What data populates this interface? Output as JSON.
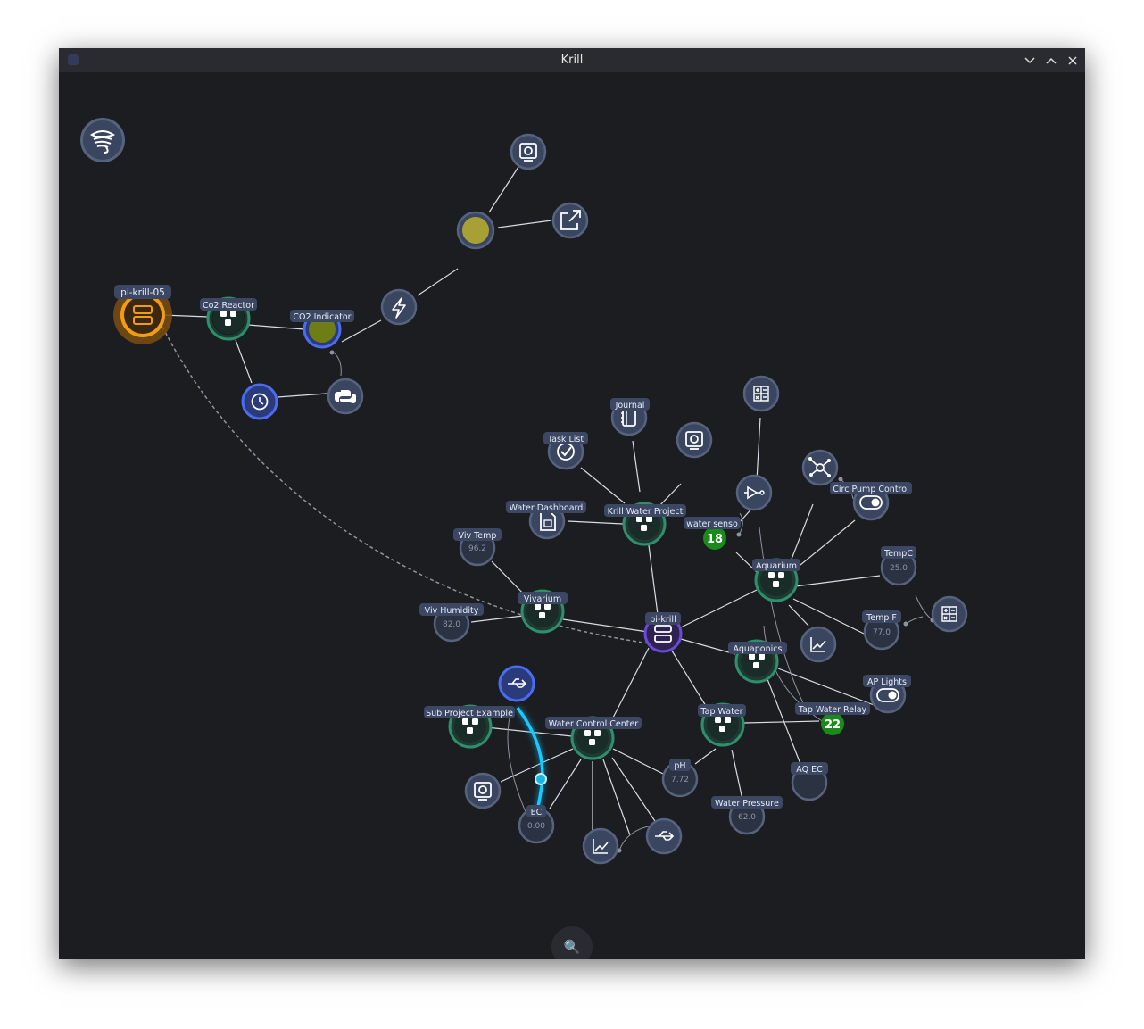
{
  "window": {
    "title": "Krill"
  },
  "search": {
    "icon": "search-icon",
    "glyph": "🔍"
  },
  "nodes": {
    "pi_krill_05": "pi-krill-05",
    "co2_reactor": "Co2 Reactor",
    "co2_indicator": "CO2 Indicator",
    "journal": "Journal",
    "task_list": "Task List",
    "water_dashboard": "Water Dashboard",
    "krill_water_project": "Krill Water Project",
    "water_sensor": "water senso",
    "circ_pump_control": "Circ Pump Control",
    "tempc": "TempC",
    "aquarium": "Aquarium",
    "temp_f": "Temp F",
    "viv_temp": "Viv Temp",
    "vivarium": "Vivarium",
    "viv_humidity": "Viv Humidity",
    "pi_krill": "pi-krill",
    "aquaponics": "Aquaponics",
    "ap_lights": "AP Lights",
    "sub_project_example": "Sub Project Example",
    "water_control_center": "Water Control Center",
    "tap_water": "Tap Water",
    "tap_water_relay": "Tap Water Relay",
    "ph": "pH",
    "aq_ec": "AQ EC",
    "ec": "EC",
    "water_pressure": "Water Pressure"
  },
  "values": {
    "viv_temp": "96.2",
    "viv_humidity": "82.0",
    "tempc": "25.0",
    "temp_f": "77.0",
    "ph": "7.72",
    "ec": "0.00",
    "water_pressure": "62.0"
  },
  "badges": {
    "water_sensor_count": "18",
    "tap_water_count": "22"
  },
  "colors": {
    "background": "#1c1d21",
    "server_orange": "#f39c12",
    "project_green": "#1e7a5a",
    "badge_green": "#1a8a1a",
    "active_blue": "#18b4e8",
    "indicator_olive": "#6e7d15"
  }
}
